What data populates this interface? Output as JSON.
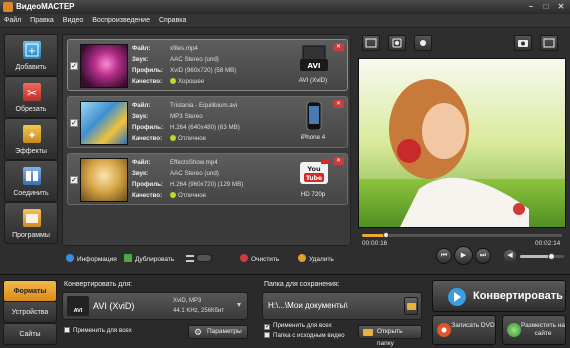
{
  "window": {
    "title": "ВидеоМАСТЕР"
  },
  "menu": [
    "Файл",
    "Правка",
    "Видео",
    "Воспроизведение",
    "Справка"
  ],
  "left_tools": [
    {
      "label": "Добавить",
      "icon": "film-add-icon",
      "color": "#3aa5d6"
    },
    {
      "label": "Обрезать",
      "icon": "scissors-icon",
      "color": "#d84b3c"
    },
    {
      "label": "Эффекты",
      "icon": "effects-icon",
      "color": "#d9a52c"
    },
    {
      "label": "Соединить",
      "icon": "join-icon",
      "color": "#5a8fd1"
    },
    {
      "label": "Программы",
      "icon": "programs-icon",
      "color": "#e0a030"
    }
  ],
  "file_labels": {
    "file": "Файл:",
    "sound": "Звук:",
    "profile": "Профиль:",
    "quality": "Качество:"
  },
  "files": [
    {
      "name": "xfiles.mp4",
      "sound": "AAC Stereo (und)",
      "profile": "XviD (960x720) (58 MB)",
      "quality": "Хорошее",
      "device": "AVI (XviD)",
      "device_icon": "avi-icon",
      "thumb_colors": [
        "#7a1a5a",
        "#e85a9a"
      ]
    },
    {
      "name": "Tristania - Equilibium.avi",
      "sound": "MP3 Stereo",
      "profile": "H.264 (640x480) (63 MB)",
      "quality": "Отличное",
      "device": "iPhone 4",
      "device_icon": "iphone-icon",
      "thumb_colors": [
        "#2d6fb8",
        "#8ed0f5"
      ]
    },
    {
      "name": "EffectsShow.mp4",
      "sound": "AAC Stereo (und)",
      "profile": "H.264 (960x720) (129 MB)",
      "quality": "Отличное",
      "device": "HD 720p",
      "device_icon": "youtube-icon",
      "thumb_colors": [
        "#d9a848",
        "#f5e3a8"
      ]
    }
  ],
  "list_toolbar": {
    "info": "Информация",
    "duplicate": "Дублировать",
    "clear": "Очистить",
    "delete": "Удалить"
  },
  "player": {
    "time_current": "00:00:16",
    "time_total": "00:02:14",
    "progress": 0.12,
    "volume": 0.7
  },
  "bottom_tabs": [
    "Форматы",
    "Устройства",
    "Сайты"
  ],
  "convert_for": {
    "label": "Конвертировать для:",
    "format": "AVI (XviD)",
    "details1": "XviD, MP3",
    "details2": "44.1 KHz, 256Кбит",
    "apply_all": "Применить для всех",
    "params": "Параметры"
  },
  "save_folder": {
    "label": "Папка для сохранения:",
    "path": "H:\\...\\Мои документы\\",
    "apply_all": "Применить для всех",
    "source_folder": "Папка с исходным видео",
    "open_folder": "Открыть папку"
  },
  "actions": {
    "convert": "Конвертировать",
    "burn_dvd": "Записать DVD",
    "publish": "Разместить на сайте"
  },
  "colors": {
    "accent": "#f0a53a",
    "convert_icon": "#3a9de0",
    "dvd": "#e0552a",
    "publish": "#3cb44a"
  }
}
